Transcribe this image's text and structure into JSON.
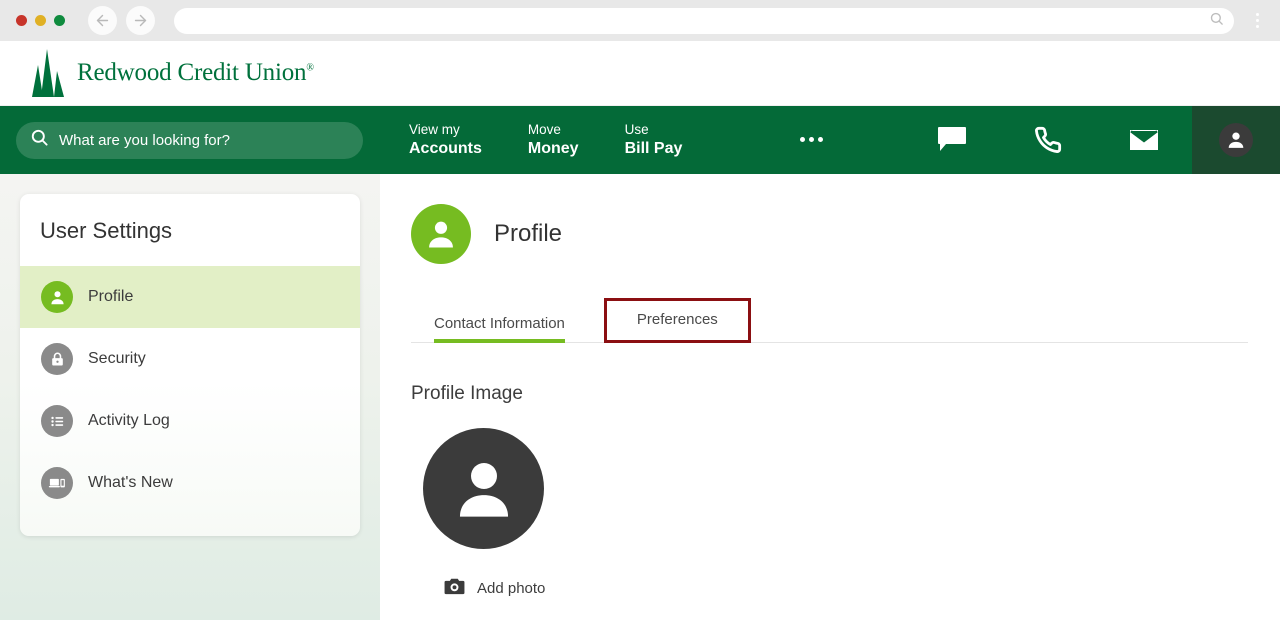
{
  "browser": {
    "url_value": "",
    "url_placeholder": "",
    "back_icon": "back-arrow-icon",
    "forward_icon": "forward-arrow-icon",
    "url_search_icon": "search-icon",
    "menu_icon": "kebab-menu-icon"
  },
  "brand": {
    "name": "Redwood Credit Union",
    "trademark": "®",
    "logo_icon": "redwood-tree-logo",
    "green": "#00713c"
  },
  "topnav": {
    "search_placeholder": "What are you looking for?",
    "search_value": "",
    "search_icon": "search-icon",
    "links": [
      {
        "small": "View my",
        "big": "Accounts"
      },
      {
        "small": "Move",
        "big": "Money"
      },
      {
        "small": "Use",
        "big": "Bill Pay"
      }
    ],
    "more_icon": "more-horizontal-icon",
    "icons": [
      {
        "name": "chat-icon"
      },
      {
        "name": "phone-icon"
      },
      {
        "name": "mail-icon"
      }
    ],
    "avatar_icon": "user-avatar-icon",
    "bar_color": "#046a38",
    "search_color": "#2c8257",
    "avatar_panel_color": "#1b4a2f"
  },
  "sidebar": {
    "title": "User Settings",
    "items": [
      {
        "label": "Profile",
        "icon": "person-icon",
        "active": true
      },
      {
        "label": "Security",
        "icon": "lock-icon",
        "active": false
      },
      {
        "label": "Activity Log",
        "icon": "list-icon",
        "active": false
      },
      {
        "label": "What's New",
        "icon": "devices-icon",
        "active": false
      }
    ],
    "active_bg": "#e2efc6",
    "active_icon_color": "#76bc21",
    "inactive_icon_color": "#8a8a8a"
  },
  "main": {
    "page_icon": "person-icon",
    "page_title": "Profile",
    "tabs": [
      {
        "label": "Contact Information",
        "active": true,
        "annotated": false
      },
      {
        "label": "Preferences",
        "active": false,
        "annotated": true
      }
    ],
    "annotation_color": "#8b0f12",
    "accent_color": "#76bc21",
    "section_title": "Profile Image",
    "avatar_icon": "person-silhouette-icon",
    "avatar_color": "#3b3b3b",
    "add_photo_label": "Add photo",
    "add_photo_icon": "camera-icon"
  }
}
